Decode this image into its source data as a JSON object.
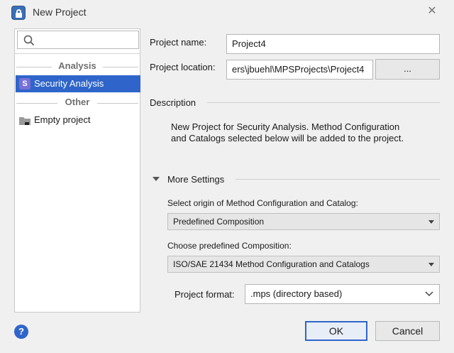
{
  "window": {
    "title": "New Project",
    "close_label": "✕",
    "app_icon": "lock-icon"
  },
  "sidebar": {
    "search": {
      "placeholder": "",
      "icon": "search-icon"
    },
    "groups": [
      {
        "label": "Analysis",
        "items": [
          {
            "label": "Security Analysis",
            "badge": "S",
            "selected": true
          }
        ]
      },
      {
        "label": "Other",
        "items": [
          {
            "label": "Empty project",
            "icon": "folder-icon",
            "selected": false
          }
        ]
      }
    ]
  },
  "form": {
    "project_name_label": "Project name:",
    "project_name_value": "Project4",
    "project_location_label": "Project location:",
    "project_location_value": "ers\\jbuehl\\MPSProjects\\Project4",
    "browse_label": "..."
  },
  "description": {
    "header": "Description",
    "text_line1": "New Project for Security Analysis. Method Configuration",
    "text_line2": "and Catalogs selected below will be added to the project."
  },
  "more_settings": {
    "header": "More Settings",
    "origin_label": "Select origin of Method Configuration and Catalog:",
    "origin_value": "Predefined Composition",
    "composition_label": "Choose predefined Composition:",
    "composition_value": "ISO/SAE 21434 Method Configuration and Catalogs",
    "format_label": "Project format:",
    "format_value": ".mps (directory based)"
  },
  "footer": {
    "help_label": "?",
    "ok_label": "OK",
    "cancel_label": "Cancel"
  },
  "colors": {
    "accent": "#2f65ca",
    "badge": "#7a6fd8",
    "background": "#f0f0f0"
  }
}
